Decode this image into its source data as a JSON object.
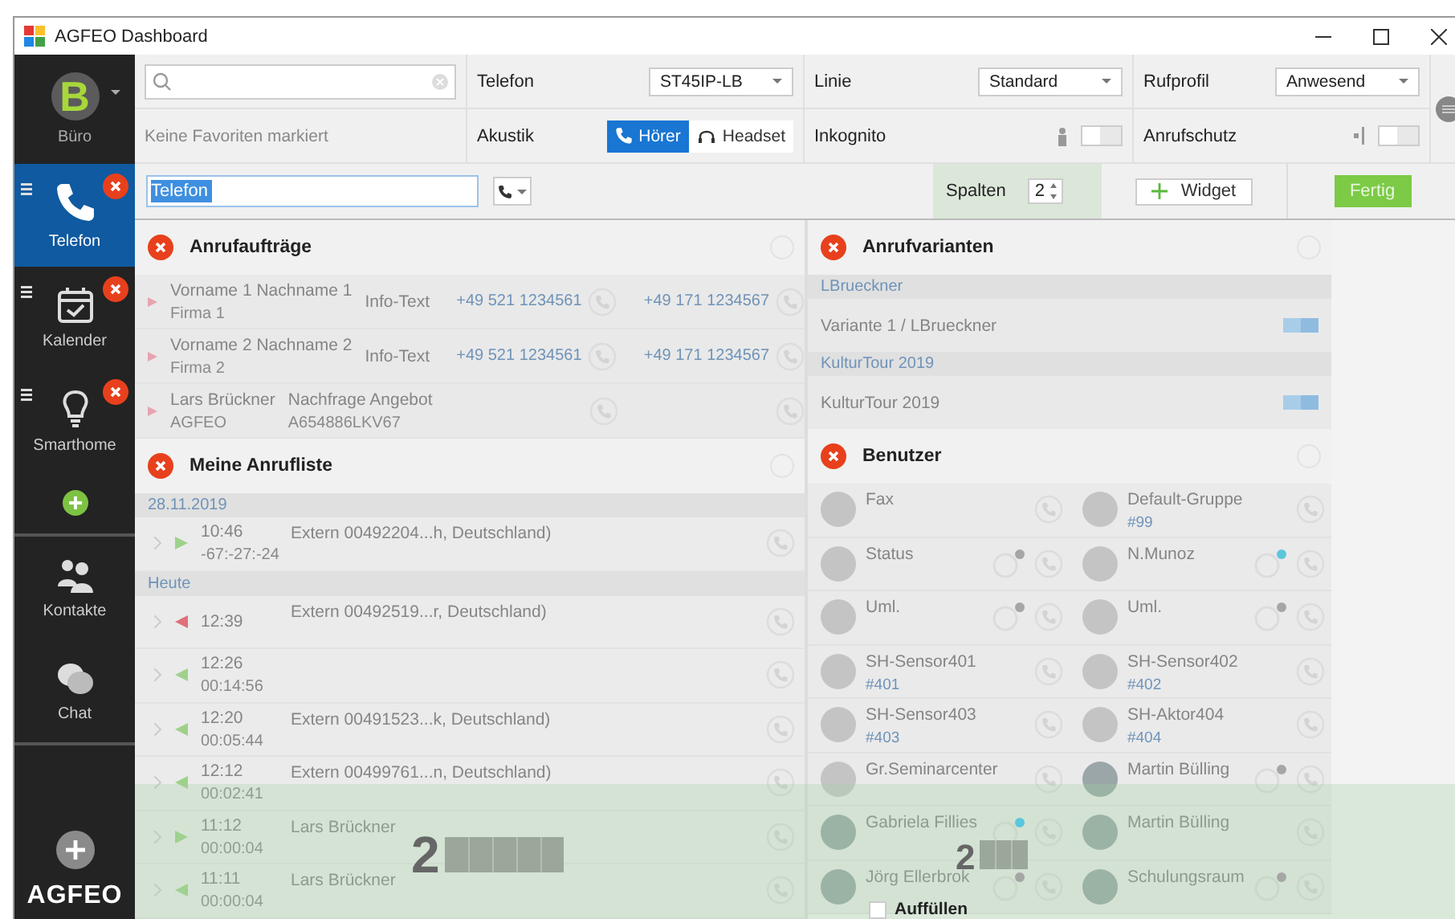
{
  "window": {
    "title": "AGFEO Dashboard"
  },
  "sidebar": {
    "profile": {
      "initial": "B",
      "label": "Büro"
    },
    "items": [
      {
        "label": "Telefon",
        "kind": "phone",
        "selected": true
      },
      {
        "label": "Kalender",
        "kind": "calendar",
        "selected": false
      },
      {
        "label": "Smarthome",
        "kind": "bulb",
        "selected": false
      }
    ],
    "links": [
      {
        "label": "Kontakte",
        "kind": "people"
      },
      {
        "label": "Chat",
        "kind": "chat"
      }
    ],
    "logo": "AGFEO"
  },
  "top_bar": {
    "favorites_text": "Keine Favoriten markiert",
    "settings": [
      {
        "label": "Telefon",
        "kind": "select",
        "value": "ST45IP-LB"
      },
      {
        "label": "Linie",
        "kind": "select",
        "value": "Standard"
      },
      {
        "label": "Rufprofil",
        "kind": "select",
        "value": "Anwesend"
      },
      {
        "label": "Akustik",
        "kind": "segmented",
        "options": [
          {
            "label": "Hörer",
            "selected": true
          },
          {
            "label": "Headset",
            "selected": false
          }
        ]
      },
      {
        "label": "Inkognito",
        "kind": "toggle",
        "on": false
      },
      {
        "label": "Anrufschutz",
        "kind": "toggle",
        "on": false
      }
    ]
  },
  "edit_bar": {
    "tab_name": "Telefon",
    "columns_label": "Spalten",
    "columns_value": "2",
    "widget_button": "Widget",
    "done_button": "Fertig"
  },
  "columns": [
    [
      {
        "kind": "tasks",
        "title": "Anrufaufträge",
        "rows": [
          {
            "name": "Vorname 1 Nachname 1",
            "company": "Firma 1",
            "info": "Info-Text",
            "phone_1": "+49 521 1234561",
            "phone_2": "+49 171 1234567"
          },
          {
            "name": "Vorname 2 Nachname 2",
            "company": "Firma 2",
            "info": "Info-Text",
            "phone_1": "+49 521 1234561",
            "phone_2": "+49 171 1234567"
          },
          {
            "name": "Lars Brückner",
            "company": "AGFEO",
            "info": "Nachfrage Angebot",
            "info_2": "A654886LKV67"
          }
        ]
      },
      {
        "kind": "calls",
        "title": "Meine Anrufliste",
        "groups": [
          {
            "date": "28.11.2019",
            "calls": [
              {
                "kind": "outgoing",
                "time": "10:46",
                "duration": "-67:-27:-24",
                "caller": "Extern 00492204...h, Deutschland)"
              }
            ]
          },
          {
            "date": "Heute",
            "calls": [
              {
                "kind": "missed",
                "time": "12:39",
                "caller": "Extern 00492519...r, Deutschland)"
              },
              {
                "kind": "incoming",
                "time": "12:26",
                "duration": "00:14:56"
              },
              {
                "kind": "incoming",
                "time": "12:20",
                "duration": "00:05:44",
                "caller": "Extern 00491523...k, Deutschland)"
              },
              {
                "kind": "incoming",
                "time": "12:12",
                "duration": "00:02:41",
                "caller": "Extern 00499761...n, Deutschland)"
              },
              {
                "kind": "outgoing",
                "time": "11:12",
                "duration": "00:00:04",
                "caller": "Lars Brückner"
              },
              {
                "kind": "incoming",
                "time": "11:11",
                "duration": "00:00:04",
                "caller": "Lars Brückner"
              }
            ]
          }
        ]
      }
    ],
    [
      {
        "kind": "variants",
        "title": "Anrufvarianten",
        "groups": [
          {
            "name": "LBrueckner",
            "variants": [
              {
                "label": "Variante 1 / LBrueckner",
                "on": true
              }
            ]
          },
          {
            "name": "KulturTour 2019",
            "variants": [
              {
                "label": "KulturTour 2019",
                "on": true
              }
            ]
          }
        ]
      },
      {
        "kind": "users",
        "title": "Benutzer",
        "users": [
          {
            "name": "Fax",
            "kind": "initial"
          },
          {
            "name": "Default-Gruppe",
            "number": "#99",
            "kind": "initial"
          },
          {
            "name": "Status",
            "kind": "initial",
            "color": "#a6a6a6"
          },
          {
            "name": "N.Munoz",
            "kind": "initial",
            "color": "#5bc6dc"
          },
          {
            "name": "Uml.",
            "kind": "initial",
            "color": "#a6a6a6"
          },
          {
            "name": "Uml.",
            "kind": "initial",
            "color": "#a6a6a6"
          },
          {
            "name": "SH-Sensor401",
            "number": "#401",
            "kind": "initial"
          },
          {
            "name": "SH-Sensor402",
            "number": "#402",
            "kind": "initial"
          },
          {
            "name": "SH-Sensor403",
            "number": "#403",
            "kind": "initial"
          },
          {
            "name": "SH-Aktor404",
            "number": "#404",
            "kind": "initial"
          },
          {
            "name": "Gr.Seminarcenter",
            "kind": "initial"
          },
          {
            "name": "Martin Bülling",
            "kind": "photo",
            "color": "#a6a6a6"
          },
          {
            "name": "Gabriela Fillies",
            "kind": "photo",
            "color": "#5bc6dc"
          },
          {
            "name": "Martin Bülling",
            "kind": "photo"
          },
          {
            "name": "Jörg Ellerbrok",
            "kind": "photo",
            "color": "#a6a6a6"
          },
          {
            "name": "Schulungsraum",
            "kind": "photo",
            "color": "#a6a6a6"
          }
        ]
      }
    ]
  ],
  "drop_zones": [
    {
      "number": "2"
    },
    {
      "number": "2",
      "fill_label": "Auffüllen",
      "fill_checked": false
    }
  ]
}
